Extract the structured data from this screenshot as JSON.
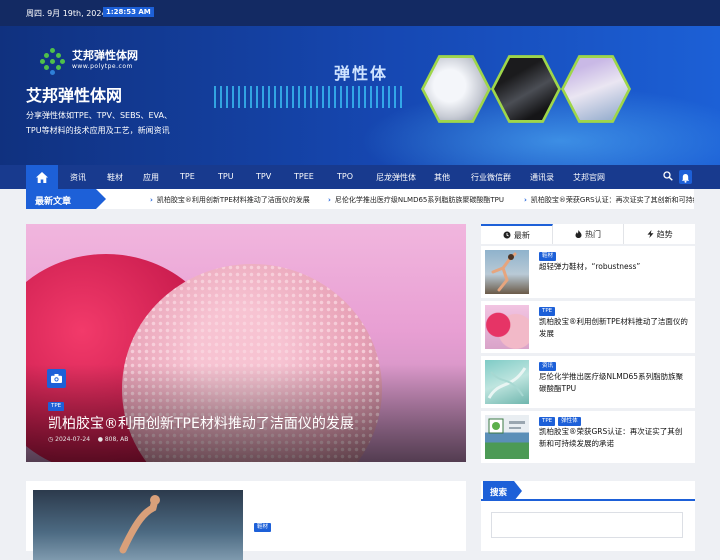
{
  "topbar": {
    "date": "周四. 9月 19th, 2024",
    "time": "1:28:53 AM"
  },
  "brand": {
    "logo_name": "艾邦弹性体网",
    "logo_url": "www.polytpe.com",
    "site_title": "艾邦弹性体网",
    "site_description": "分享弹性体如TPE、TPV、SEBS、EVA、TPU等材料的技术应用及工艺，新闻资讯",
    "banner_word": "弹性体"
  },
  "nav": {
    "items": [
      "资讯",
      "鞋材",
      "应用",
      "TPE",
      "TPU",
      "TPV",
      "TPEE",
      "TPO",
      "尼龙弹性体",
      "其他",
      "行业微信群",
      "通讯录",
      "艾邦官网"
    ],
    "icons": {
      "home": "home-icon",
      "search": "search-icon",
      "bell": "bell-icon"
    }
  },
  "ticker": {
    "label": "最新文章",
    "items": [
      "凯柏胶宝®利用创新TPE材料推动了洁面仪的发展",
      "尼伦化学推出医疗级NLMD65系列脂肪族聚碳酸酯TPU",
      "凯柏胶宝®荣获GRS认证：再次证实了其创新和可持续发展的承"
    ]
  },
  "hero": {
    "tag": "TPE",
    "title": "凯柏胶宝®利用创新TPE材料推动了洁面仪的发展",
    "date": "2024-07-24",
    "author": "808, AB"
  },
  "tabs": [
    {
      "label": "最新",
      "icon": "clock-icon",
      "active": true
    },
    {
      "label": "热门",
      "icon": "fire-icon",
      "active": false
    },
    {
      "label": "趋势",
      "icon": "bolt-icon",
      "active": false
    }
  ],
  "sidebar_posts": [
    {
      "tags": [
        "鞋材"
      ],
      "title": "超轻弹力鞋材，“robustness”"
    },
    {
      "tags": [
        "TPE"
      ],
      "title": "凯柏胶宝®利用创新TPE材料推动了洁面仪的发展"
    },
    {
      "tags": [
        "资讯"
      ],
      "title": "尼伦化学推出医疗级NLMD65系列脂肪族聚碳酸酯TPU"
    },
    {
      "tags": [
        "TPE",
        "弹性体"
      ],
      "title": "凯柏胶宝®荣获GRS认证：再次证实了其创新和可持续发展的承诺"
    }
  ],
  "lower_post": {
    "tag": "鞋材"
  },
  "search_widget": {
    "heading": "搜索",
    "placeholder": ""
  },
  "colors": {
    "accent": "#1d60d8",
    "nav": "#183a8e",
    "topbar": "#132a63"
  }
}
